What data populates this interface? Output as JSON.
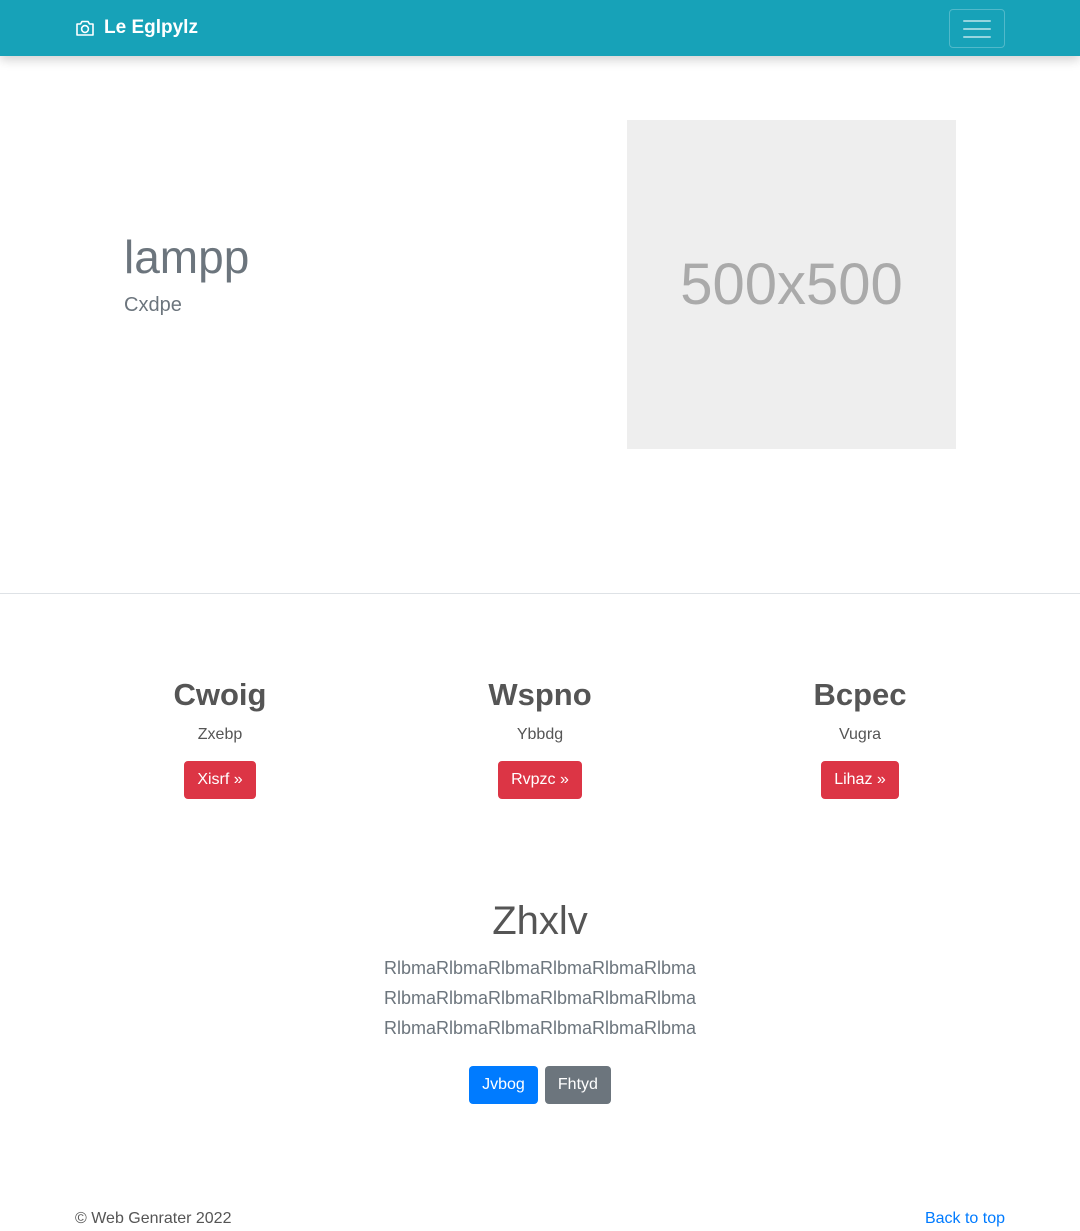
{
  "navbar": {
    "brand": "Le Eglpylz",
    "brand_icon": "camera-icon",
    "toggler_icon": "hamburger-menu-icon",
    "background": "#17a2b8"
  },
  "hero": {
    "title": "lampp",
    "subtitle": "Cxdpe",
    "image_text": "500x500"
  },
  "features": [
    {
      "title": "Cwoig",
      "text": "Zxebp",
      "button": "Xisrf »"
    },
    {
      "title": "Wspno",
      "text": "Ybbdg",
      "button": "Rvpzc »"
    },
    {
      "title": "Bcpec",
      "text": "Vugra",
      "button": "Lihaz »"
    }
  ],
  "cta": {
    "title": "Zhxlv",
    "lines": [
      "RlbmaRlbmaRlbmaRlbmaRlbmaRlbma",
      "RlbmaRlbmaRlbmaRlbmaRlbmaRlbma",
      "RlbmaRlbmaRlbmaRlbmaRlbmaRlbma"
    ],
    "primary_button": "Jvbog",
    "secondary_button": "Fhtyd"
  },
  "footer": {
    "copyright": "© Web Genrater 2022",
    "back_to_top": "Back to top"
  },
  "colors": {
    "danger": "#dc3545",
    "primary": "#007bff",
    "secondary": "#6c757d"
  }
}
